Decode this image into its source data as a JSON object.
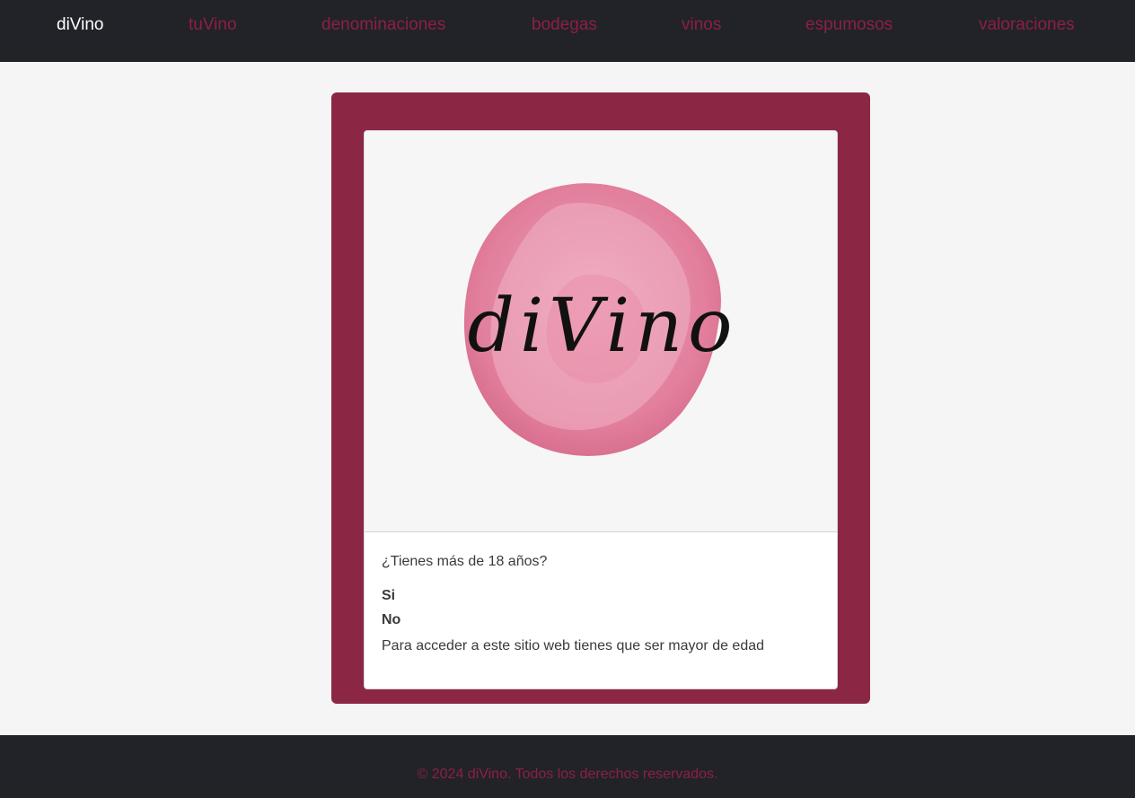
{
  "nav": {
    "brand": "diVino",
    "links": [
      "tuVino",
      "denominaciones",
      "bodegas",
      "vinos",
      "espumosos",
      "valoraciones"
    ]
  },
  "logo": {
    "wordmark": "diVino",
    "icon": "watercolor-stain-logo"
  },
  "age_gate": {
    "question": "¿Tienes más de 18 años?",
    "option_yes": "Si",
    "option_no": "No",
    "notice": "Para acceder a este sitio web tienes que ser mayor de edad"
  },
  "footer": {
    "copyright": "© 2024 diVino. Todos los derechos reservados."
  },
  "colors": {
    "navbar": "#212328",
    "accent": "#8e1f43",
    "frame": "#8c2645",
    "stain": "#e48aa6"
  }
}
